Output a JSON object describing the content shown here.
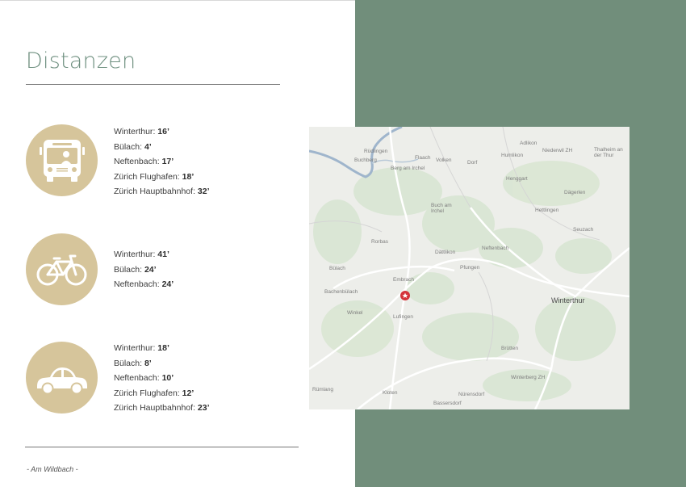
{
  "title": "Distanzen",
  "footer": "- Am Wildbach -",
  "groups": [
    {
      "icon": "bus-icon",
      "lines": [
        {
          "place": "Winterthur",
          "time": "16’"
        },
        {
          "place": "Bülach",
          "time": "4’"
        },
        {
          "place": "Neftenbach",
          "time": "17’"
        },
        {
          "place": "Zürich Flughafen",
          "time": "18’"
        },
        {
          "place": "Zürich Hauptbahnhof",
          "time": "32’"
        }
      ]
    },
    {
      "icon": "bicycle-icon",
      "lines": [
        {
          "place": "Winterthur",
          "time": "41’"
        },
        {
          "place": "Bülach",
          "time": "24’"
        },
        {
          "place": "Neftenbach",
          "time": "24’"
        }
      ]
    },
    {
      "icon": "car-icon",
      "lines": [
        {
          "place": "Winterthur",
          "time": "18’"
        },
        {
          "place": "Bülach",
          "time": "8’"
        },
        {
          "place": "Neftenbach",
          "time": "10’"
        },
        {
          "place": "Zürich Flughafen",
          "time": "12’"
        },
        {
          "place": "Zürich Hauptbahnhof",
          "time": "23’"
        }
      ]
    }
  ],
  "map": {
    "labels": [
      "Rüdlingen",
      "Flaach",
      "Volken",
      "Humlikon",
      "Adlikon",
      "Niederwil ZH",
      "Thalheim an der Thur",
      "Buchberg",
      "Berg am Irchel",
      "Dorf",
      "Henggart",
      "Dägerlen",
      "Buch am Irchel",
      "Hettlingen",
      "Seuzach",
      "Rorbas",
      "Dättlikon",
      "Neftenbach",
      "Bülach",
      "Pfungen",
      "Embrach",
      "Bachenbülach",
      "Winterthur",
      "Winkel",
      "Lufingen",
      "Brütten",
      "Winterberg ZH",
      "Rümlang",
      "Kloten",
      "Nürensdorf",
      "Bassersdorf"
    ]
  },
  "colors": {
    "accent_green": "#718e7b",
    "icon_circle": "#d6c59b",
    "title": "#6f9080",
    "marker": "#d4343a"
  }
}
